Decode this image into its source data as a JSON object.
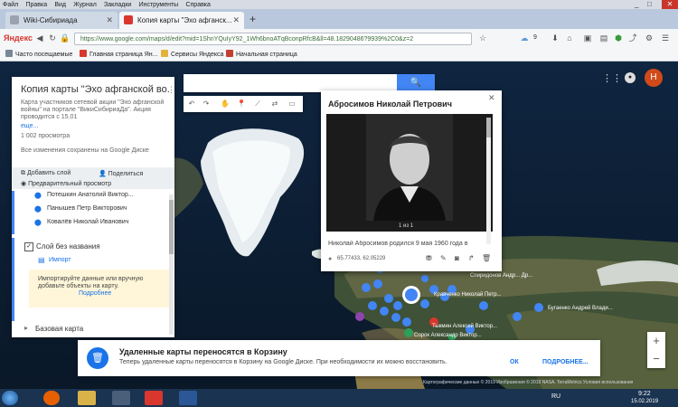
{
  "os_menu": [
    "Файл",
    "Правка",
    "Вид",
    "Журнал",
    "Закладки",
    "Инструменты",
    "Справка"
  ],
  "tabs": [
    {
      "title": "Wiki-Сибириада",
      "active": false,
      "favicon_color": "#9aa3ad"
    },
    {
      "title": "Копия карты \"Эхо афганск...",
      "active": true,
      "favicon_color": "#d9372d"
    }
  ],
  "new_tab_label": "+",
  "browser": {
    "brand": "Яндекс",
    "url": "https://www.google.com/maps/d/edit?mid=1ShnYQuIyY92_1Wh6bnoATqBconpRfcB&ll=48.18290486?9939%2C0&z=2",
    "weather_count": "9"
  },
  "bookmarks": [
    {
      "label": "Часто посещаемые",
      "color": "#7a8797"
    },
    {
      "label": "Главная страница Ян...",
      "color": "#d9372d"
    },
    {
      "label": "Сервисы Яндекса",
      "color": "#e2b23a"
    },
    {
      "label": "Начальная страница",
      "color": "#c43f2f"
    }
  ],
  "panel": {
    "title": "Копия карты \"Эхо афганской во...",
    "description": "Карта участников сетевой акции \"Эхо афганской войны\" на портале \"ВикиСибириаДа\". Акция проводится с 15.01",
    "more_link": "еще...",
    "views": "1 002 просмотра",
    "saved": "Все изменения сохранены на Google Диске",
    "add_layer": "Добавить слой",
    "share": "Поделиться",
    "preview": "Предварительный просмотр",
    "people": [
      "Потешкин Анатолий Виктор...",
      "Панышев Петр Викторович",
      "Ковалёв Николай Иванович"
    ],
    "layer_name": "Слой без названия",
    "import_label": "Импорт",
    "import_hint": "Импортируйте данные или вручную добавьте объекты на карту.",
    "import_more": "Подробнее",
    "base_map": "Базовая карта"
  },
  "popup": {
    "title": "Абросимов Николай Петрович",
    "counter": "1 из 1",
    "caption": "Николай Абросимов родился 9 мая 1960 года в",
    "coords": "65.77433, 62.05229"
  },
  "map_labels": [
    "Кравченко Николай Петр...",
    "Бугаенко Андрей Влади...",
    "Спиридонов Андр... Др...",
    "Тыкмин Алексей Виктор...",
    "Сорок Александр Виктор..."
  ],
  "notice": {
    "title": "Удаленные карты переносятся в Корзину",
    "text": "Теперь удаленные карты переносятся в Корзину на Google Диске. При необходимости их можно восстановить.",
    "ok": "ОК",
    "more": "ПОДРОБНЕЕ..."
  },
  "attribution": "Картографические данные © 2019 Изображения © 2019 NASA, TerraMetrics   Условия использования",
  "zoom": {
    "in": "+",
    "out": "−"
  },
  "user_initial": "Н",
  "taskbar": {
    "lang": "RU",
    "time": "9:22",
    "date": "15.02.2019"
  },
  "colors": {
    "accent": "#4285f4",
    "avatar": "#d14a1a",
    "layer_bar": "#4285f4"
  }
}
